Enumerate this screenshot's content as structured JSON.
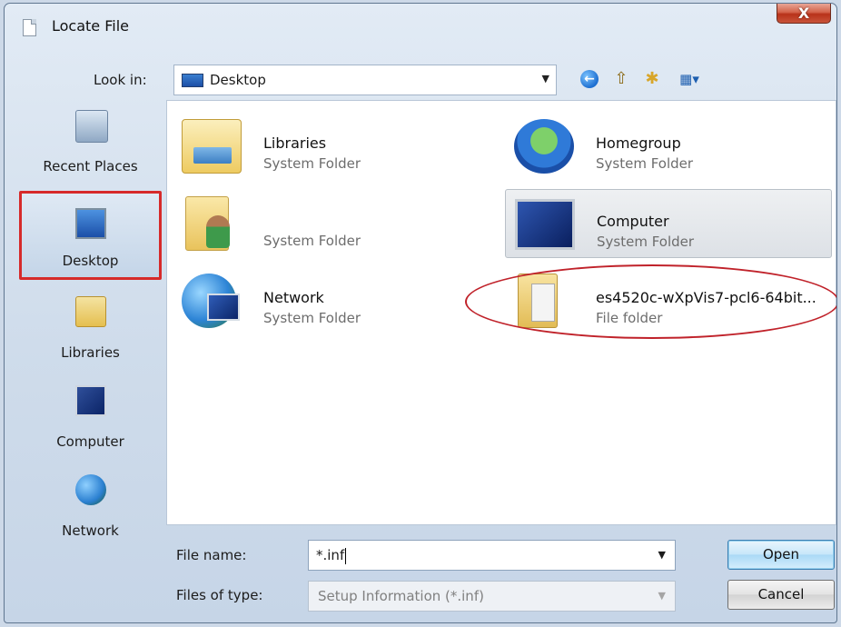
{
  "window": {
    "title": "Locate File",
    "close_glyph": "X"
  },
  "look_in": {
    "label": "Look in:",
    "value": "Desktop",
    "icon": "desktop-icon"
  },
  "toolbar": {
    "back_icon": "back-arrow-icon",
    "up_icon": "up-folder-icon",
    "new_folder_icon": "new-folder-icon",
    "view_icon": "view-menu-icon",
    "back_glyph": "←",
    "up_glyph": "⇧",
    "new_folder_glyph": "✱",
    "view_glyph": "▦▾"
  },
  "places": [
    {
      "label": "Recent Places",
      "icon": "recent-places-icon",
      "selected": false
    },
    {
      "label": "Desktop",
      "icon": "desktop-icon",
      "selected": true
    },
    {
      "label": "Libraries",
      "icon": "libraries-icon",
      "selected": false
    },
    {
      "label": "Computer",
      "icon": "computer-icon",
      "selected": false
    },
    {
      "label": "Network",
      "icon": "network-icon",
      "selected": false
    }
  ],
  "items": [
    {
      "name": "Libraries",
      "type": "System Folder",
      "icon": "libraries-icon"
    },
    {
      "name": "Homegroup",
      "type": "System Folder",
      "icon": "homegroup-icon"
    },
    {
      "name": "",
      "type": "System Folder",
      "icon": "user-folder-icon"
    },
    {
      "name": "Computer",
      "type": "System Folder",
      "icon": "computer-icon",
      "highlighted": true
    },
    {
      "name": "Network",
      "type": "System Folder",
      "icon": "network-icon"
    },
    {
      "name": "es4520c-wXpVis7-pcl6-64bit...",
      "type": "File folder",
      "icon": "folder-icon",
      "circled": true
    }
  ],
  "file_name": {
    "label": "File name:",
    "value": "*.inf"
  },
  "file_type": {
    "label": "Files of type:",
    "value": "Setup Information (*.inf)"
  },
  "buttons": {
    "open": "Open",
    "cancel": "Cancel"
  },
  "colors": {
    "annotation_red": "#c0222a",
    "selection_border": "#d62a2a",
    "default_button": "#3c7fb1"
  }
}
